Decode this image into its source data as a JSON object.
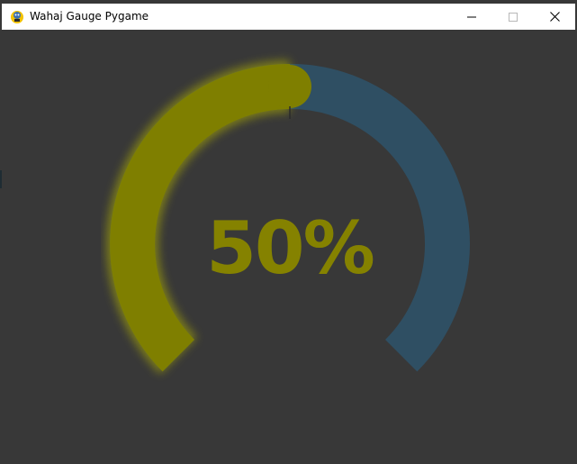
{
  "window": {
    "title": "Wahaj Gauge Pygame"
  },
  "icons": {
    "app": "pygame-snake-icon",
    "minimize": "minimize-icon",
    "maximize": "maximize-icon",
    "close": "close-icon"
  },
  "gauge": {
    "value_text": "50%",
    "value_fraction": 0.5,
    "colors": {
      "filled": "#7f7f00",
      "glow": "#b3b300",
      "track": "#2f4f63",
      "text": "#858200",
      "background": "#383838"
    }
  }
}
